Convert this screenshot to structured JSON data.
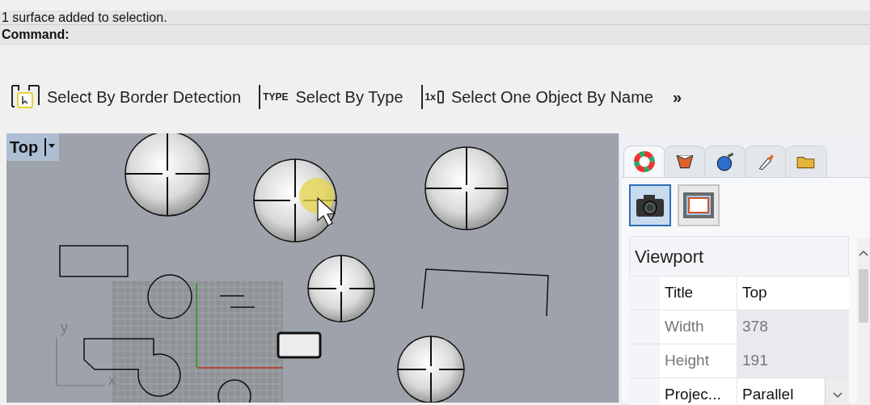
{
  "command_history": {
    "message": "1 surface added to selection."
  },
  "command_line": {
    "prompt": "Command:"
  },
  "toolbar": {
    "buttons": [
      {
        "kind": "border",
        "label": "Select By Border Detection"
      },
      {
        "kind": "type",
        "label": "Select By Type",
        "icon_text": "TYPE"
      },
      {
        "kind": "name",
        "label": "Select One Object By Name",
        "icon_text": "1x"
      }
    ],
    "overflow": "»"
  },
  "viewport": {
    "title": "Top",
    "axis_labels": [
      "y",
      "x"
    ]
  },
  "panel": {
    "tabs": [
      {
        "kind": "color",
        "selected": true
      },
      {
        "kind": "layers",
        "selected": false
      },
      {
        "kind": "render",
        "selected": false
      },
      {
        "kind": "brush",
        "selected": false
      },
      {
        "kind": "folder",
        "selected": false
      }
    ],
    "view_buttons": [
      {
        "kind": "camera",
        "selected": true
      },
      {
        "kind": "frame",
        "selected": false
      }
    ],
    "section": "Viewport",
    "properties": [
      {
        "name": "Title",
        "value": "Top",
        "disabled": false,
        "kind": "text"
      },
      {
        "name": "Width",
        "value": "378",
        "disabled": true,
        "kind": "text"
      },
      {
        "name": "Height",
        "value": "191",
        "disabled": true,
        "kind": "text"
      },
      {
        "name": "Projec...",
        "value": "Parallel",
        "disabled": false,
        "kind": "dropdown"
      }
    ]
  }
}
